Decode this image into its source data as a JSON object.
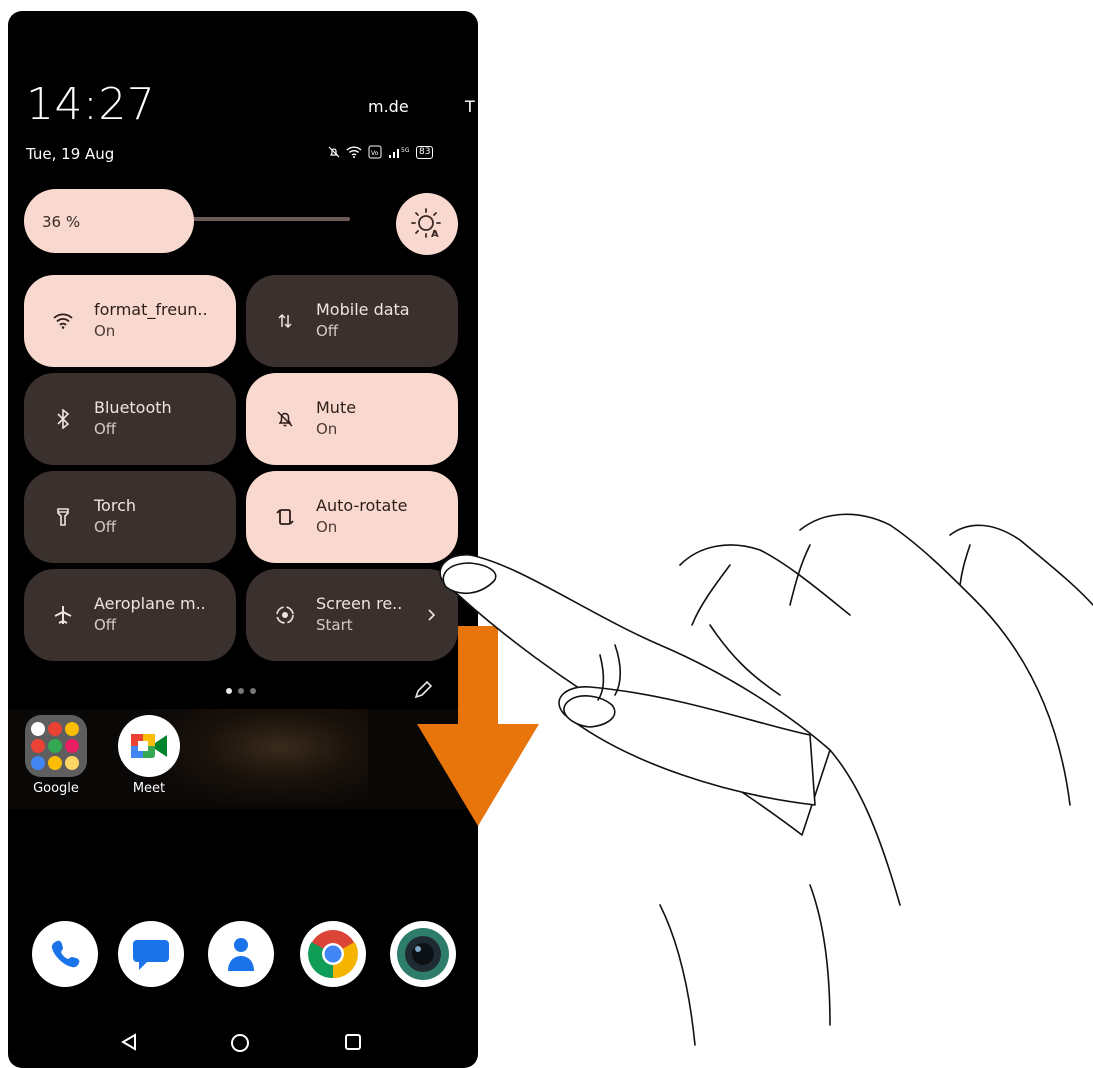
{
  "status": {
    "time": "14:27",
    "date": "Tue, 19 Aug",
    "carrier": "m.de",
    "carrier2": "T",
    "battery": "83"
  },
  "brightness": {
    "percent_label": "36 %",
    "level": 0.36
  },
  "tiles": [
    {
      "title": "format_freun..",
      "state": "On",
      "active": true,
      "icon": "wifi-icon"
    },
    {
      "title": "Mobile data",
      "state": "Off",
      "active": false,
      "icon": "mobile-data-icon"
    },
    {
      "title": "Bluetooth",
      "state": "Off",
      "active": false,
      "icon": "bluetooth-icon"
    },
    {
      "title": "Mute",
      "state": "On",
      "active": true,
      "icon": "mute-bell-icon"
    },
    {
      "title": "Torch",
      "state": "Off",
      "active": false,
      "icon": "torch-icon"
    },
    {
      "title": "Auto-rotate",
      "state": "On",
      "active": true,
      "icon": "auto-rotate-icon"
    },
    {
      "title": "Aeroplane m..",
      "state": "Off",
      "active": false,
      "icon": "aeroplane-icon"
    },
    {
      "title": "Screen re..",
      "state": "Start",
      "active": false,
      "icon": "screen-record-icon"
    }
  ],
  "home": {
    "apps": [
      {
        "label": "Google",
        "icon": "google-folder-icon"
      },
      {
        "label": "Meet",
        "icon": "meet-icon"
      }
    ],
    "dock": [
      {
        "icon": "phone-icon"
      },
      {
        "icon": "messages-icon"
      },
      {
        "icon": "contacts-icon"
      },
      {
        "icon": "chrome-icon"
      },
      {
        "icon": "camera-icon"
      }
    ]
  },
  "colors": {
    "tile_on": "#f9d9cf",
    "tile_off": "#3a302d",
    "arrow": "#e8740c"
  }
}
